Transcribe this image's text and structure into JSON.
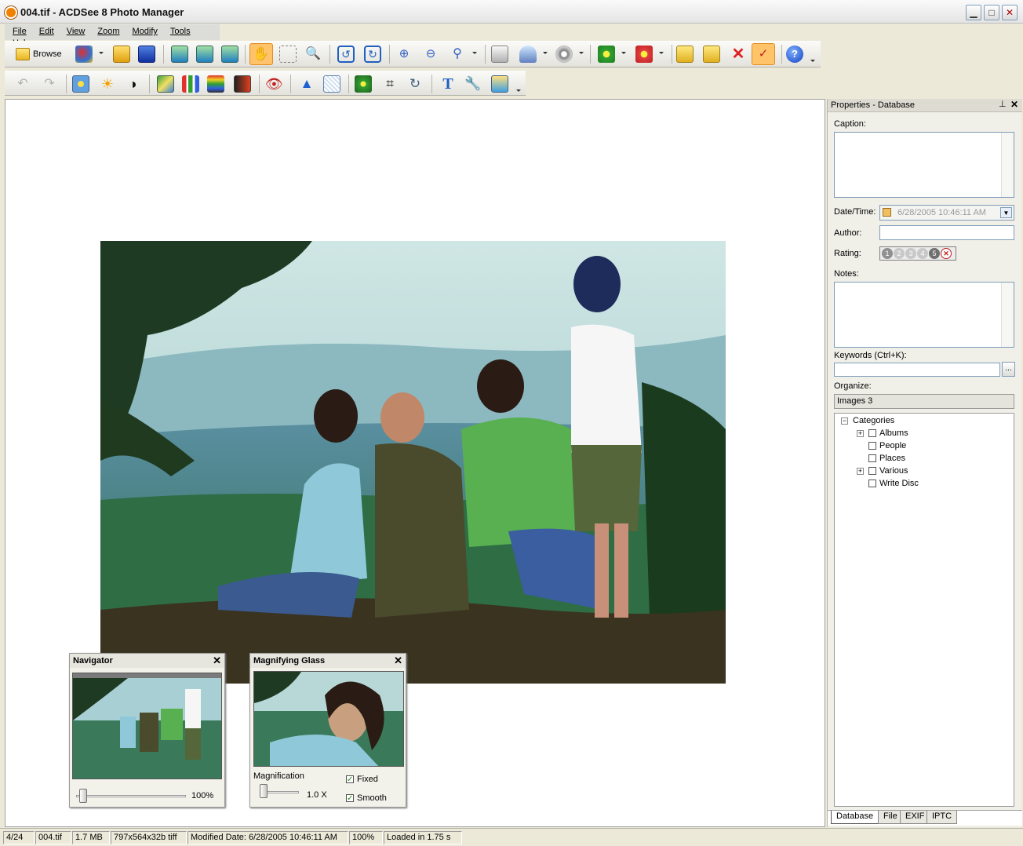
{
  "window": {
    "title": "004.tif - ACDSee 8 Photo Manager",
    "buttons": [
      "▁",
      "□",
      "✕"
    ]
  },
  "menu": [
    "File",
    "Edit",
    "View",
    "Zoom",
    "Modify",
    "Tools",
    "Help"
  ],
  "toolbar": {
    "browse_label": "Browse"
  },
  "navigator": {
    "title": "Navigator",
    "close": "✕",
    "zoom": "100%",
    "zoom_fraction": 0.0
  },
  "magnifier": {
    "title": "Magnifying Glass",
    "close": "✕",
    "label": "Magnification",
    "value": "1.0 X",
    "fixed_label": "Fixed",
    "smooth_label": "Smooth",
    "fixed_checked": true,
    "smooth_checked": true
  },
  "properties": {
    "title": "Properties - Database",
    "caption_label": "Caption:",
    "datetime_label": "Date/Time:",
    "datetime_value": "6/28/2005 10:46:11 AM",
    "author_label": "Author:",
    "rating_label": "Rating:",
    "rating_values": [
      "1",
      "2",
      "3",
      "4",
      "5"
    ],
    "notes_label": "Notes:",
    "keywords_label": "Keywords (Ctrl+K):",
    "keywords_button": "...",
    "organize_label": "Organize:",
    "organize_value": "Images 3",
    "categories": {
      "root": "Categories",
      "items": [
        {
          "label": "Albums",
          "expandable": true
        },
        {
          "label": "People",
          "expandable": false
        },
        {
          "label": "Places",
          "expandable": false
        },
        {
          "label": "Various",
          "expandable": true
        },
        {
          "label": "Write Disc",
          "expandable": false
        }
      ]
    },
    "tabs": [
      "Database",
      "File",
      "EXIF",
      "IPTC"
    ],
    "active_tab": "Database"
  },
  "statusbar": [
    "4/24",
    "004.tif",
    "1.7 MB",
    "797x564x32b tiff",
    "Modified Date: 6/28/2005 10:46:11 AM",
    "100%",
    "Loaded in 1.75 s"
  ],
  "colors": {
    "accent": "#316ac5",
    "selected_tool": "#ffc46a"
  }
}
